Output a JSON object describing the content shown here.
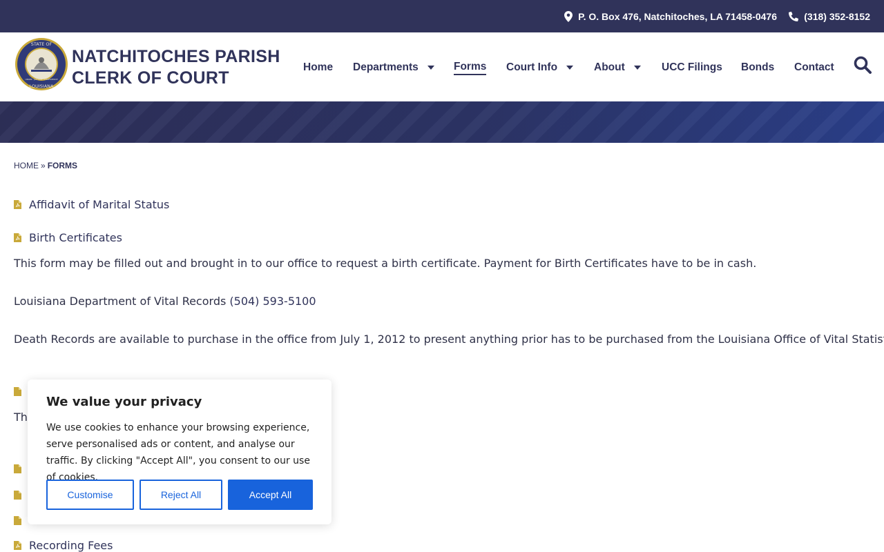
{
  "topbar": {
    "address": "P. O. Box 476, Natchitoches, LA 71458-0476",
    "phone": "(318) 352-8152"
  },
  "brand": {
    "line1": "NATCHITOCHES PARISH",
    "line2": "CLERK OF COURT",
    "seal_text": [
      "STATE OF",
      "LOUISIANA",
      "UNION · JUSTICE · CONFIDENCE"
    ]
  },
  "nav": {
    "items": [
      {
        "label": "Home"
      },
      {
        "label": "Departments"
      },
      {
        "label": "Forms"
      },
      {
        "label": "Court Info"
      },
      {
        "label": "About"
      },
      {
        "label": "UCC Filings"
      },
      {
        "label": "Bonds"
      },
      {
        "label": "Contact"
      }
    ]
  },
  "breadcrumb": {
    "home": "HOME",
    "separator": "»",
    "current": "FORMS"
  },
  "content": {
    "links": [
      {
        "label": "Affidavit of Marital Status"
      },
      {
        "label": "Birth Certificates"
      },
      {
        "label": "Recording Fees"
      }
    ],
    "birth_note": "This form may be filled out and brought in to our office to request a birth certificate. Payment for Birth Certificates have to be in cash.",
    "vital_records_label": "Louisiana Department of Vital Records ",
    "vital_records_phone": "(504) 593-5100",
    "death_note": "Death Records are available to purchase in the office from July 1, 2012 to present anything prior has to be purchased from the Louisiana Office of Vital Statistics.",
    "partial_text": "Th"
  },
  "cookie": {
    "title": "We value your privacy",
    "body": "We use cookies to enhance your browsing experience, serve personalised ads or content, and analyse our traffic. By clicking \"Accept All\", you consent to our use of cookies.",
    "customise": "Customise",
    "reject": "Reject All",
    "accept": "Accept All"
  },
  "colors": {
    "navy": "#30335a",
    "accent_gold": "#c9a93a",
    "cookie_blue": "#1863dc"
  }
}
